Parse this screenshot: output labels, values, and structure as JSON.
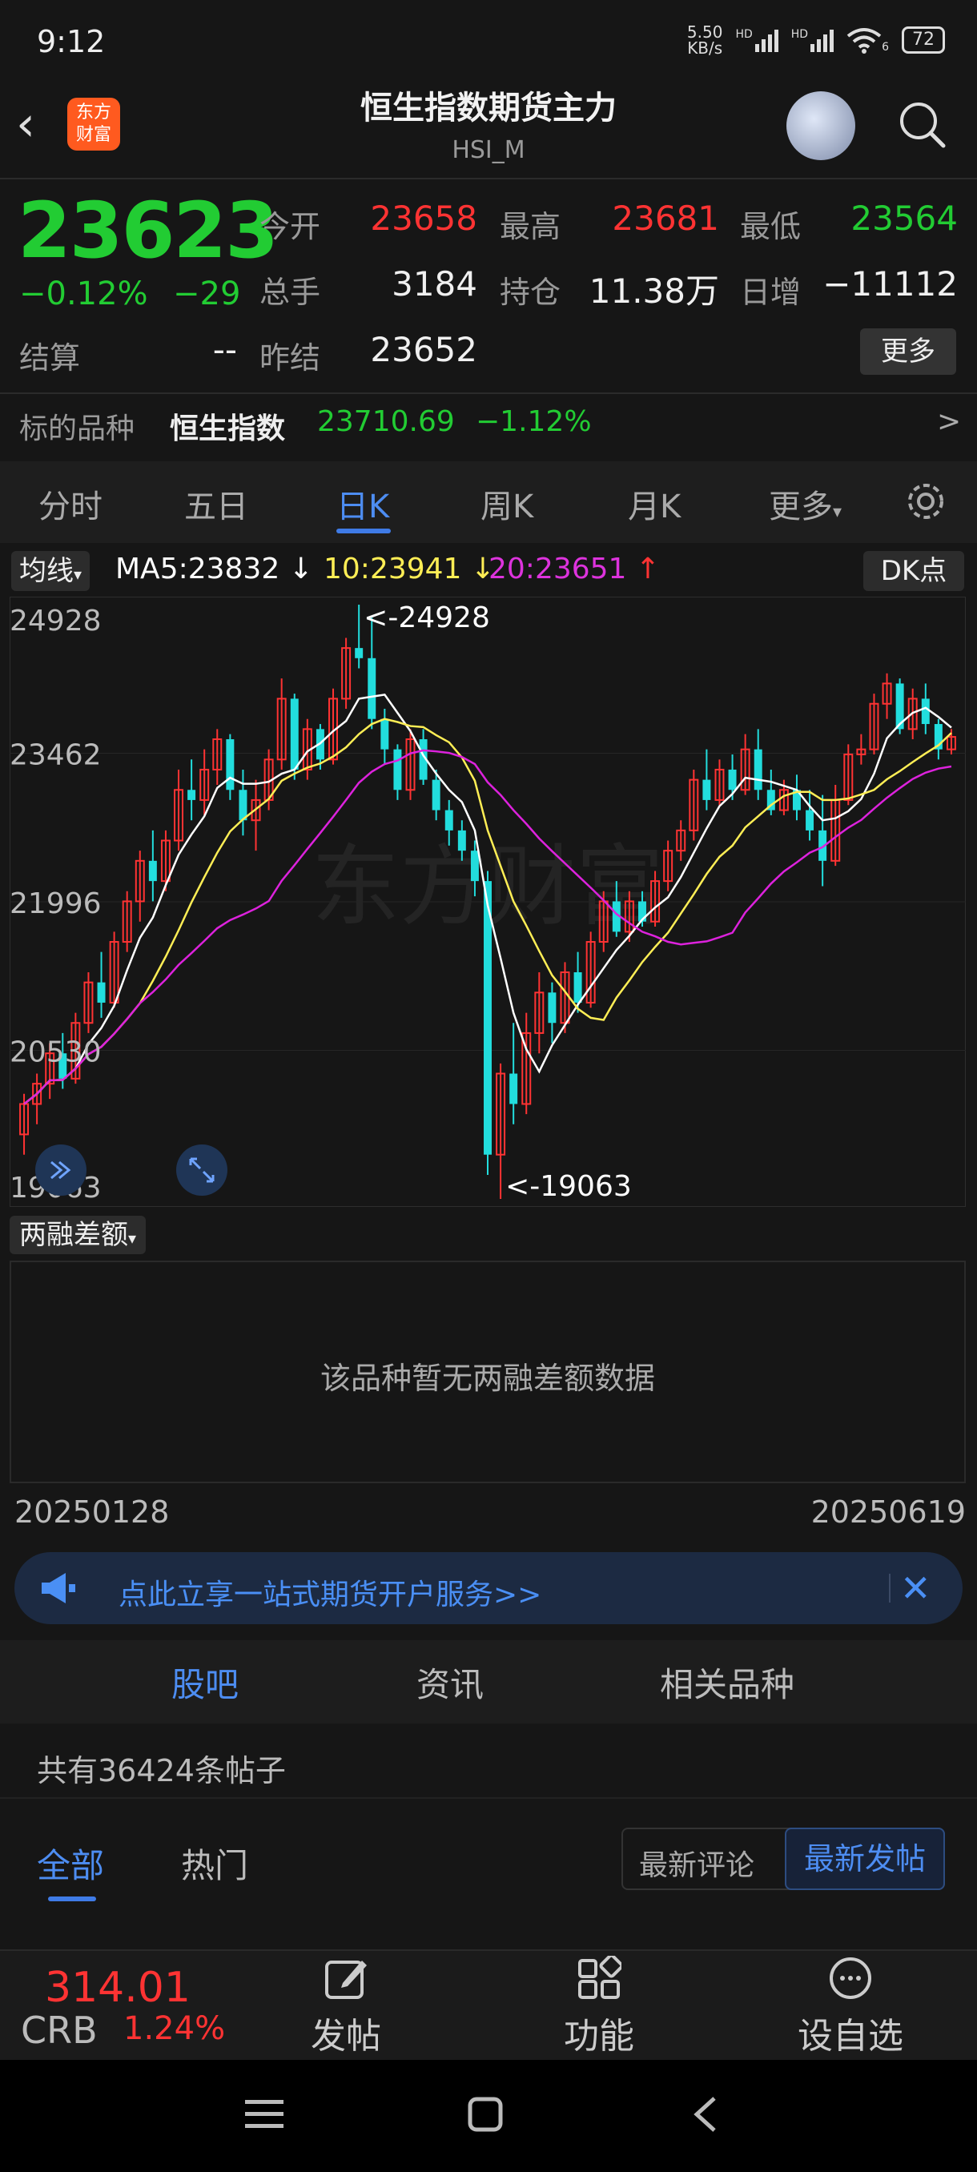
{
  "status": {
    "time": "9:12",
    "net_speed_value": "5.50",
    "net_speed_unit": "KB/s",
    "sig_label": "HD",
    "battery": "72",
    "wifi_badge": "6"
  },
  "header": {
    "title": "恒生指数期货主力",
    "subtitle": "HSI_M",
    "logo_text": "东方财富"
  },
  "quote": {
    "last_price": "23623",
    "change_pct": "−0.12%",
    "change": "−29",
    "open_label": "今开",
    "open": "23658",
    "high_label": "最高",
    "high": "23681",
    "low_label": "最低",
    "low": "23564",
    "volume_label": "总手",
    "volume": "3184",
    "oi_label": "持仓",
    "oi": "11.38万",
    "daily_inc_label": "日增",
    "daily_inc": "−11112",
    "settle_label": "结算",
    "settle": "--",
    "prev_settle_label": "昨结",
    "prev_settle": "23652",
    "more_label": "更多"
  },
  "underlying": {
    "label": "标的品种",
    "name": "恒生指数",
    "price": "23710.69",
    "change_pct": "−1.12%",
    "arrow": ">"
  },
  "chart_tabs": [
    "分时",
    "五日",
    "日K",
    "周K",
    "月K",
    "更多"
  ],
  "ma_bar": {
    "selector": "均线",
    "ma5": "MA5:23832",
    "ma5_arrow": "↓",
    "ma10": "10:23941",
    "ma10_arrow": "↓",
    "ma20": "20:23651",
    "ma20_arrow": "↑",
    "dk_label": "DK点"
  },
  "chart_data": {
    "type": "candlestick",
    "y_ticks": [
      "24928",
      "23462",
      "21996",
      "20530",
      "19063"
    ],
    "ylim": [
      19063,
      24928
    ],
    "max_label": "<-24928",
    "min_label": "<-19063",
    "x_start": "20250128",
    "x_end": "20250619",
    "watermark": "东方财富",
    "colors": {
      "up": "#ff3333",
      "down": "#22dddd",
      "ma5": "#ffffff",
      "ma10": "#ffee55",
      "ma20": "#dd22dd"
    },
    "candles": [
      [
        19700,
        20100,
        19500,
        20000
      ],
      [
        20000,
        20300,
        19800,
        20200
      ],
      [
        20200,
        20600,
        20050,
        20500
      ],
      [
        20500,
        20700,
        20150,
        20250
      ],
      [
        20250,
        20900,
        20200,
        20800
      ],
      [
        20800,
        21300,
        20700,
        21200
      ],
      [
        21200,
        21500,
        20850,
        21000
      ],
      [
        21000,
        21700,
        20950,
        21600
      ],
      [
        21600,
        22100,
        21500,
        22000
      ],
      [
        22000,
        22500,
        21800,
        22400
      ],
      [
        22400,
        22700,
        22000,
        22200
      ],
      [
        22200,
        22700,
        22100,
        22600
      ],
      [
        22600,
        23300,
        22500,
        23100
      ],
      [
        23100,
        23400,
        22800,
        23000
      ],
      [
        23000,
        23500,
        22850,
        23300
      ],
      [
        23300,
        23700,
        23150,
        23600
      ],
      [
        23600,
        23650,
        23000,
        23100
      ],
      [
        23100,
        23300,
        22650,
        22800
      ],
      [
        22800,
        23200,
        22500,
        23000
      ],
      [
        23000,
        23500,
        22900,
        23400
      ],
      [
        23400,
        24200,
        23300,
        24000
      ],
      [
        24000,
        24050,
        23200,
        23300
      ],
      [
        23300,
        23800,
        23200,
        23700
      ],
      [
        23700,
        23750,
        23300,
        23400
      ],
      [
        23400,
        24100,
        23350,
        24000
      ],
      [
        24000,
        24600,
        23900,
        24500
      ],
      [
        24500,
        24928,
        24300,
        24400
      ],
      [
        24400,
        24800,
        23700,
        23800
      ],
      [
        23800,
        23900,
        23350,
        23500
      ],
      [
        23500,
        23550,
        23000,
        23100
      ],
      [
        23100,
        23700,
        23000,
        23600
      ],
      [
        23600,
        23700,
        23150,
        23200
      ],
      [
        23200,
        23300,
        22800,
        22900
      ],
      [
        22900,
        23000,
        22550,
        22700
      ],
      [
        22700,
        22800,
        22400,
        22500
      ],
      [
        22500,
        22600,
        22050,
        22200
      ],
      [
        22200,
        22300,
        19300,
        19500
      ],
      [
        19500,
        20400,
        19063,
        20300
      ],
      [
        20300,
        20800,
        19800,
        20000
      ],
      [
        20000,
        20900,
        19900,
        20700
      ],
      [
        20700,
        21300,
        20500,
        21100
      ],
      [
        21100,
        21200,
        20600,
        20800
      ],
      [
        20800,
        21400,
        20700,
        21300
      ],
      [
        21300,
        21500,
        20900,
        21000
      ],
      [
        21000,
        21700,
        20950,
        21600
      ],
      [
        21600,
        22100,
        21500,
        22000
      ],
      [
        22000,
        22200,
        21650,
        21700
      ],
      [
        21700,
        22100,
        21600,
        22000
      ],
      [
        22000,
        22100,
        21750,
        21800
      ],
      [
        21800,
        22300,
        21750,
        22200
      ],
      [
        22200,
        22600,
        22100,
        22500
      ],
      [
        22500,
        22800,
        22400,
        22700
      ],
      [
        22700,
        23300,
        22600,
        23200
      ],
      [
        23200,
        23500,
        22900,
        23000
      ],
      [
        23000,
        23400,
        22950,
        23300
      ],
      [
        23300,
        23450,
        23000,
        23100
      ],
      [
        23100,
        23650,
        23050,
        23500
      ],
      [
        23500,
        23700,
        23000,
        23100
      ],
      [
        23100,
        23300,
        22850,
        22900
      ],
      [
        22900,
        23200,
        22850,
        23100
      ],
      [
        23100,
        23250,
        22800,
        22900
      ],
      [
        22900,
        23100,
        22600,
        22700
      ],
      [
        22700,
        23050,
        22150,
        22400
      ],
      [
        22400,
        23150,
        22350,
        23000
      ],
      [
        23000,
        23550,
        22950,
        23450
      ],
      [
        23450,
        23650,
        23350,
        23500
      ],
      [
        23500,
        24050,
        23450,
        23950
      ],
      [
        23950,
        24250,
        23800,
        24150
      ],
      [
        24150,
        24200,
        23650,
        23700
      ],
      [
        23700,
        24100,
        23600,
        24000
      ],
      [
        24000,
        24150,
        23650,
        23750
      ],
      [
        23750,
        23800,
        23400,
        23500
      ],
      [
        23500,
        23700,
        23450,
        23623
      ]
    ]
  },
  "indicator": {
    "selector": "两融差额",
    "empty_text": "该品种暂无两融差额数据"
  },
  "banner": {
    "text": "点此立享一站式期货开户服务>>"
  },
  "content_tabs": [
    "股吧",
    "资讯",
    "相关品种"
  ],
  "forum": {
    "post_count": "共有36424条帖子",
    "filters": [
      "全部",
      "热门"
    ],
    "sort_latest_comment": "最新评论",
    "sort_latest_post": "最新发帖"
  },
  "bottom_bar": {
    "ticker_value": "314.01",
    "ticker_name": "CRB",
    "ticker_change": "1.24%",
    "post": "发帖",
    "functions": "功能",
    "add_watch": "设自选"
  }
}
